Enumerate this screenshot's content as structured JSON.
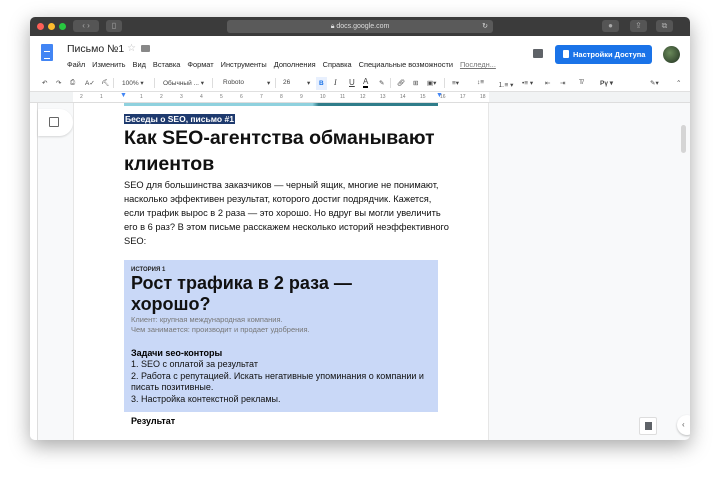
{
  "browser": {
    "url": "docs.google.com"
  },
  "header": {
    "title": "Письмо №1",
    "share_label": "Настройки Доступа",
    "menu": [
      "Файл",
      "Изменить",
      "Вид",
      "Вставка",
      "Формат",
      "Инструменты",
      "Дополнения",
      "Справка",
      "Специальные возможности",
      "Последн..."
    ]
  },
  "toolbar": {
    "zoom": "100%",
    "style": "Обычный ...",
    "font": "Roboto",
    "size": "26",
    "bold": "B",
    "italic": "I",
    "underline": "U",
    "color": "A",
    "input_tools": "Рү"
  },
  "ruler": [
    "2",
    "1",
    "1",
    "2",
    "3",
    "4",
    "5",
    "6",
    "7",
    "8",
    "9",
    "10",
    "11",
    "12",
    "13",
    "14",
    "15",
    "16",
    "17",
    "18"
  ],
  "document": {
    "subtitle": "Беседы о SEO, письмо #1",
    "heading": "Как SEO-агентства обманывают клиентов",
    "intro": "SEO для большинства заказчиков — черный ящик, многие не понимают, насколько эффективен результат, которого достиг подрядчик. Кажется, если трафик вырос в 2 раза — это хорошо. Но вдруг вы могли увеличить его в 6 раз? В этом письме расскажем несколько историй неэффективного SEO:",
    "story": {
      "label": "ИСТОРИЯ 1",
      "title": "Рост трафика в 2 раза — хорошо?",
      "client": "Клиент: крупная международная компания.",
      "business": "Чем занимается: производит и продает удобрения.",
      "tasks_title": "Задачи seo-конторы",
      "tasks": [
        "1. SEO с оплатой за результат",
        "2. Работа с репутацией. Искать негативные упоминания о компании и писать позитивные.",
        "3. Настройка контекстной рекламы."
      ],
      "result_title": "Результат"
    }
  }
}
